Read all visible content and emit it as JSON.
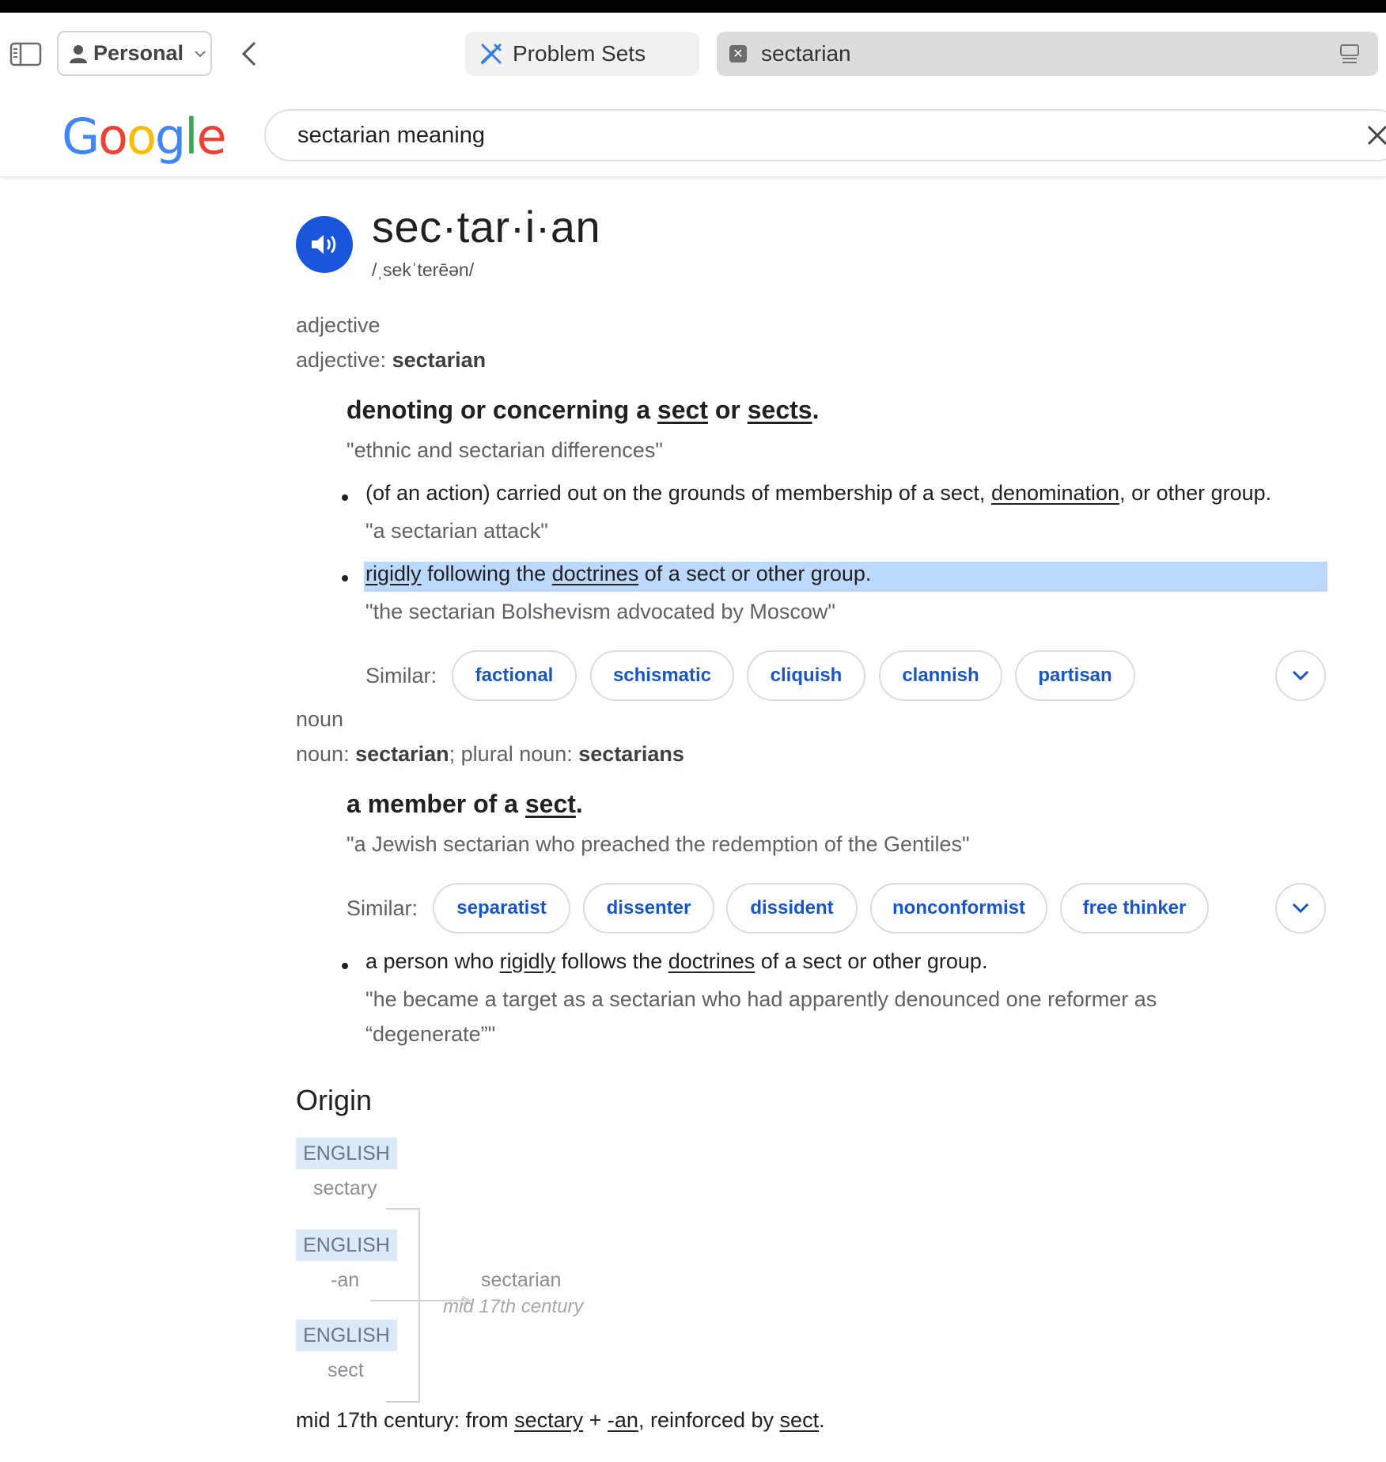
{
  "browser": {
    "profile_label": "Personal",
    "tabs": [
      {
        "label": "Problem Sets",
        "active": false
      },
      {
        "label": "sectarian",
        "active": true
      }
    ]
  },
  "search": {
    "query": "sectarian meaning",
    "logo_letters": [
      "G",
      "o",
      "o",
      "g",
      "l",
      "e"
    ],
    "logo_colors": [
      "#4285F4",
      "#EA4335",
      "#FBBC05",
      "#4285F4",
      "#34A853",
      "#EA4335"
    ]
  },
  "entry": {
    "headword": "sec·tar·i·an",
    "pronunciation": "/ˌsekˈterēən/",
    "adjective": {
      "pos": "adjective",
      "form_prefix": "adjective: ",
      "form_word": "sectarian",
      "definition": {
        "prefix": "denoting or concerning a ",
        "link1": "sect",
        "mid": " or ",
        "link2": "sects",
        "suffix": "."
      },
      "example": "\"ethnic and sectarian differences\"",
      "senses": [
        {
          "text_pre": "(of an action) carried out on the grounds of membership of a sect, ",
          "link": "denomination",
          "text_post": ", or other group.",
          "example": "\"a sectarian attack\""
        },
        {
          "link1": "rigidly",
          "text_mid1": " following the ",
          "link2": "doctrines",
          "text_post": " of a sect or other group.",
          "example": "\"the sectarian Bolshevism advocated by Moscow\""
        }
      ],
      "similar_label": "Similar:",
      "similar": [
        "factional",
        "schismatic",
        "cliquish",
        "clannish",
        "partisan"
      ]
    },
    "noun": {
      "pos": "noun",
      "form_prefix": "noun: ",
      "form_word": "sectarian",
      "plural_prefix": "; plural noun: ",
      "plural_word": "sectarians",
      "definition": {
        "prefix": "a member of a ",
        "link": "sect",
        "suffix": "."
      },
      "example": "\"a Jewish sectarian who preached the redemption of the Gentiles\"",
      "similar_label": "Similar:",
      "similar": [
        "separatist",
        "dissenter",
        "dissident",
        "nonconformist",
        "free thinker"
      ],
      "senses": [
        {
          "text_pre": "a person who ",
          "link1": "rigidly",
          "text_mid": " follows the ",
          "link2": "doctrines",
          "text_post": " of a sect or other group.",
          "example_line1": "\"he became a target as a sectarian who had apparently denounced one reformer as",
          "example_line2": "“degenerate”\""
        }
      ]
    },
    "origin": {
      "title": "Origin",
      "tag": "ENGLISH",
      "sources": [
        "sectary",
        "-an",
        "sect"
      ],
      "result": "sectarian",
      "result_date": "mid 17th century",
      "etymology": {
        "prefix": "mid 17th century: from ",
        "link1": "sectary",
        "plus": " + ",
        "link2": "-an",
        "mid": ", reinforced by ",
        "link3": "sect",
        "suffix": "."
      }
    }
  }
}
